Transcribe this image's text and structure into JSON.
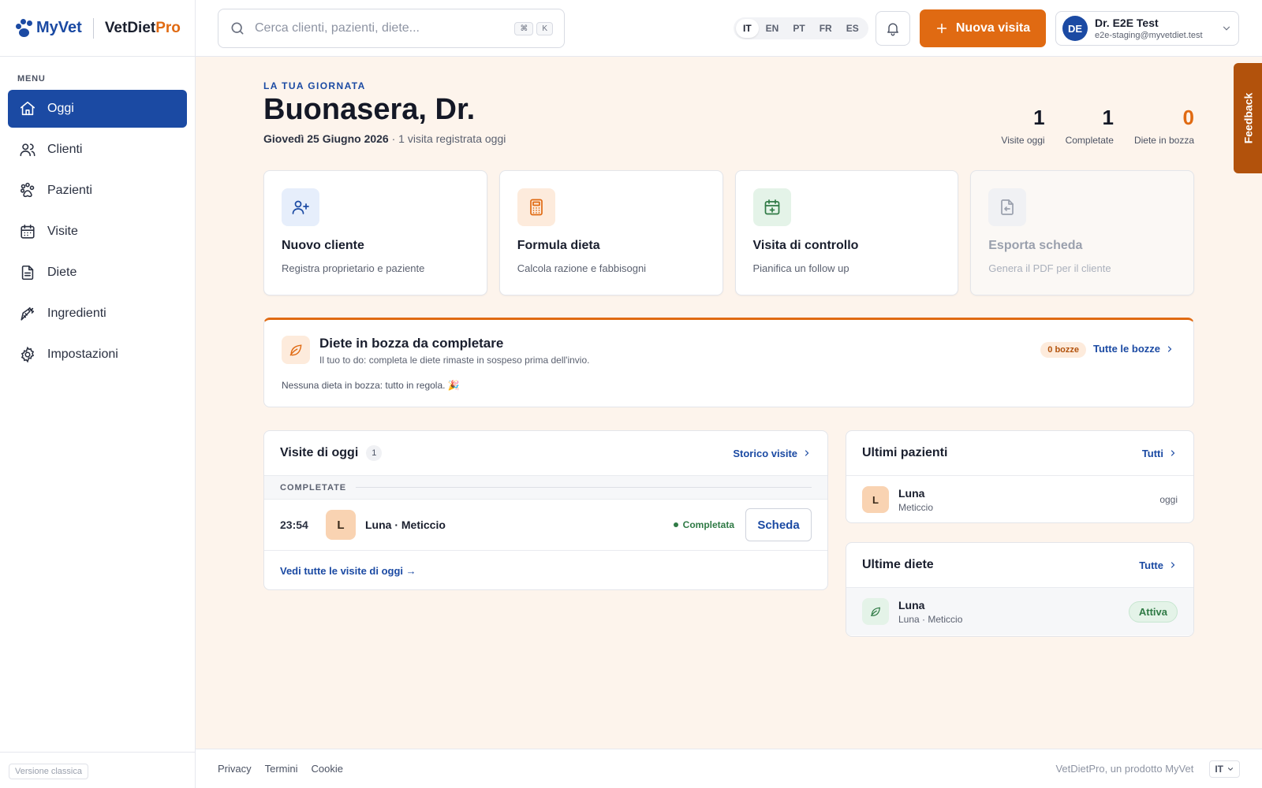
{
  "brand": {
    "myvet": "MyVet",
    "vetdiet": "VetDiet",
    "pro": "Pro"
  },
  "sidebar": {
    "menu_label": "MENU",
    "items": [
      {
        "label": "Oggi",
        "icon": "home-icon"
      },
      {
        "label": "Clienti",
        "icon": "users-icon"
      },
      {
        "label": "Pazienti",
        "icon": "paw-icon"
      },
      {
        "label": "Visite",
        "icon": "calendar-icon"
      },
      {
        "label": "Diete",
        "icon": "document-icon"
      },
      {
        "label": "Ingredienti",
        "icon": "carrot-icon"
      },
      {
        "label": "Impostazioni",
        "icon": "gear-icon"
      }
    ],
    "classic_version": "Versione classica"
  },
  "topbar": {
    "search_placeholder": "Cerca clienti, pazienti, diete...",
    "kbd_cmd": "⌘",
    "kbd_k": "K",
    "languages": [
      "IT",
      "EN",
      "PT",
      "FR",
      "ES"
    ],
    "active_language": "IT",
    "new_visit": "Nuova visita",
    "user": {
      "initials": "DE",
      "name": "Dr. E2E Test",
      "email": "e2e-staging@myvetdiet.test"
    }
  },
  "header": {
    "eyebrow": "LA TUA GIORNATA",
    "greeting": "Buonasera, Dr.",
    "date": "Giovedì 25 Giugno 2026",
    "date_suffix": " · 1 visita registrata oggi",
    "stats": [
      {
        "value": "1",
        "label": "Visite oggi"
      },
      {
        "value": "1",
        "label": "Completate"
      },
      {
        "value": "0",
        "label": "Diete in bozza"
      }
    ]
  },
  "quick_actions": [
    {
      "title": "Nuovo cliente",
      "subtitle": "Registra proprietario e paziente",
      "icon": "user-plus-icon",
      "color": "#1b4aa3",
      "bg": "#e6eefb"
    },
    {
      "title": "Formula dieta",
      "subtitle": "Calcola razione e fabbisogni",
      "icon": "calculator-icon",
      "color": "#e06a12",
      "bg": "#fdebdc"
    },
    {
      "title": "Visita di controllo",
      "subtitle": "Pianifica un follow up",
      "icon": "calendar-plus-icon",
      "color": "#2f7a45",
      "bg": "#e4f3e8"
    },
    {
      "title": "Esporta scheda",
      "subtitle": "Genera il PDF per il cliente",
      "icon": "file-export-icon",
      "color": "#9aa0ad",
      "bg": "#f0f1f4"
    }
  ],
  "drafts": {
    "title": "Diete in bozza da completare",
    "subtitle": "Il tuo to do: completa le diete rimaste in sospeso prima dell'invio.",
    "count": "0 bozze",
    "link": "Tutte le bozze",
    "empty": "Nessuna dieta in bozza: tutto in regola. 🎉"
  },
  "visits": {
    "title": "Visite di oggi",
    "count": "1",
    "history_link": "Storico visite",
    "section": "COMPLETATE",
    "rows": [
      {
        "time": "23:54",
        "initial": "L",
        "name": "Luna · Meticcio",
        "status": "Completata",
        "action": "Scheda"
      }
    ],
    "all_link": "Vedi tutte le visite di oggi →"
  },
  "patients": {
    "title": "Ultimi pazienti",
    "link": "Tutti",
    "items": [
      {
        "initial": "L",
        "name": "Luna",
        "breed": "Meticcio",
        "when": "oggi"
      }
    ]
  },
  "diets": {
    "title": "Ultime diete",
    "link": "Tutte",
    "items": [
      {
        "name": "Luna",
        "sub": "Luna · Meticcio",
        "status": "Attiva"
      }
    ]
  },
  "footer": {
    "links": [
      "Privacy",
      "Termini",
      "Cookie"
    ],
    "product": "VetDietPro, un prodotto MyVet",
    "language": "IT"
  },
  "feedback": "Feedback",
  "colors": {
    "primary": "#1b4aa3",
    "accent": "#e06a12",
    "success": "#2f7a45",
    "page_bg": "#fdf4ec"
  }
}
